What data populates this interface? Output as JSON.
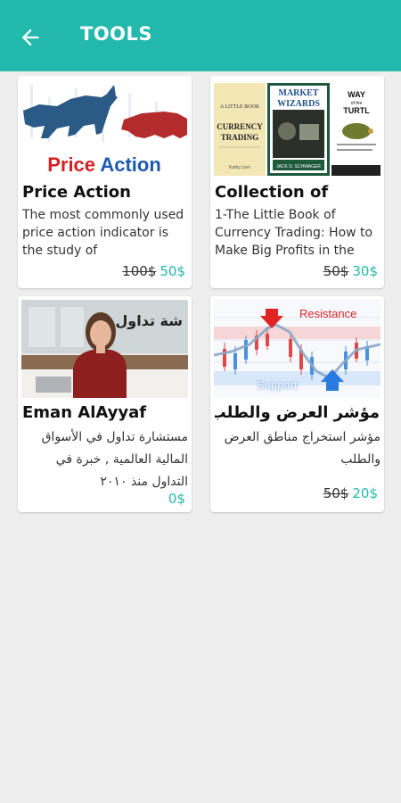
{
  "app_bar": {
    "title": "TOOLS",
    "background": "#22b8ac"
  },
  "cards": [
    {
      "image_banner": "Price Action",
      "title": "Price Action",
      "description": "The most commonly used price action indicator is the study of",
      "old_price": "100$",
      "price": "50$"
    },
    {
      "title": "Collection of",
      "description": "1-The Little Book of Currency Trading: How to Make Big Profits in the",
      "old_price": "50$",
      "price": "30$",
      "books": [
        {
          "line1": "A LITTLE BOOK",
          "line2": "CURRENCY TRADING"
        },
        {
          "line1": "MARKET",
          "line2": "WIZARDS"
        },
        {
          "line1": "WAY",
          "line2": "of the TURTL"
        }
      ]
    },
    {
      "image_text": "شة تداول",
      "title": "Eman AlAyyaf",
      "description": "مستشارة تداول في الأسواق المالية العالمية , خبرة في التداول منذ ٢٠١٠",
      "price": "0$"
    },
    {
      "chart_labels": {
        "resistance": "Resistance",
        "support": "Support"
      },
      "title": "مؤشر العرض والطلب",
      "description": "مؤشر استخراج مناطق العرض والطلب",
      "old_price": "50$",
      "price": "20$"
    }
  ]
}
